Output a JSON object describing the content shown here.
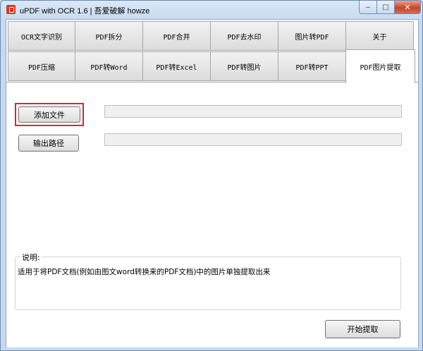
{
  "window": {
    "title": "uPDF with OCR 1.6 | 吾爱破解 howze",
    "min_glyph": "‒",
    "max_glyph": "□",
    "close_glyph": "✕"
  },
  "tabs_row1": [
    {
      "name": "tab-ocr",
      "label": "OCR文字识别"
    },
    {
      "name": "tab-pdf-split",
      "label": "PDF拆分"
    },
    {
      "name": "tab-pdf-merge",
      "label": "PDF合并"
    },
    {
      "name": "tab-pdf-remove-watermark",
      "label": "PDF去水印"
    },
    {
      "name": "tab-image-to-pdf",
      "label": "图片转PDF"
    },
    {
      "name": "tab-about",
      "label": "关于"
    }
  ],
  "tabs_row2": [
    {
      "name": "tab-pdf-compress",
      "label": "PDF压缩"
    },
    {
      "name": "tab-pdf-to-word",
      "label": "PDF转Word"
    },
    {
      "name": "tab-pdf-to-excel",
      "label": "PDF转Excel"
    },
    {
      "name": "tab-pdf-to-image",
      "label": "PDF转图片"
    },
    {
      "name": "tab-pdf-to-ppt",
      "label": "PDF转PPT"
    },
    {
      "name": "tab-pdf-extract-images",
      "label": "PDF图片提取",
      "active": true
    }
  ],
  "panel": {
    "add_file_label": "添加文件",
    "file_path_value": "",
    "output_path_label": "输出路径",
    "output_path_value": "",
    "desc_label": "说明:",
    "desc_text": "适用于将PDF文档(例如由图文word转换来的PDF文档)中的图片单独提取出来",
    "start_label": "开始提取"
  },
  "colors": {
    "highlight": "#d7262e",
    "close_button": "#c7452a",
    "titlebar": "#c6d9ee"
  }
}
